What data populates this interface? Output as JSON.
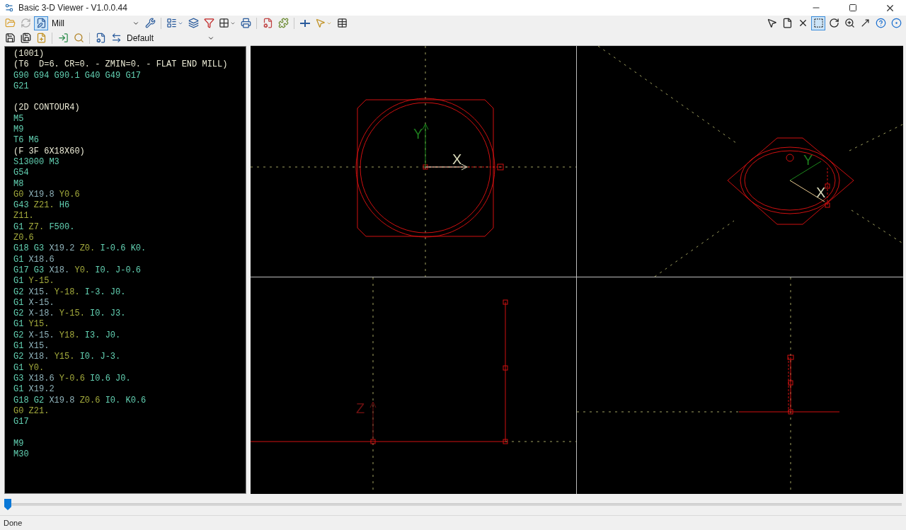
{
  "window": {
    "title": "Basic 3-D Viewer - V1.0.0.44"
  },
  "toolbar": {
    "machine": "Mill",
    "profile": "Default",
    "left_tools": [
      {
        "selected": false
      },
      {
        "selected": false
      },
      {
        "selected": true
      }
    ],
    "right_tools": [
      {
        "selected": false
      },
      {
        "selected": false
      },
      {
        "selected": false
      },
      {
        "selected": true
      },
      {
        "selected": false
      },
      {
        "selected": false
      },
      {
        "selected": false
      },
      {
        "selected": false
      },
      {
        "selected": false
      }
    ]
  },
  "program": [
    {
      "kind": "code",
      "tokens": [
        {
          "text": "(1001)",
          "kind": "note"
        }
      ]
    },
    {
      "kind": "code",
      "tokens": [
        {
          "text": "(T6  D=6. CR=0. - ZMIN=0. - FLAT END MILL)",
          "kind": "note"
        }
      ]
    },
    {
      "kind": "code",
      "tokens": [
        {
          "text": "G90 G94 G90.1 G40 G49 G17",
          "kind": "word"
        }
      ]
    },
    {
      "kind": "code",
      "tokens": [
        {
          "text": "G21",
          "kind": "word"
        }
      ]
    },
    {
      "kind": "blank"
    },
    {
      "kind": "code",
      "tokens": [
        {
          "text": "(2D CONTOUR4)",
          "kind": "note"
        }
      ]
    },
    {
      "kind": "code",
      "tokens": [
        {
          "text": "M5",
          "kind": "word"
        }
      ]
    },
    {
      "kind": "code",
      "tokens": [
        {
          "text": "M9",
          "kind": "word"
        }
      ]
    },
    {
      "kind": "code",
      "tokens": [
        {
          "text": "T6 M6",
          "kind": "word"
        }
      ]
    },
    {
      "kind": "code",
      "tokens": [
        {
          "text": "(F 3F 6X18X60)",
          "kind": "note"
        }
      ]
    },
    {
      "kind": "code",
      "tokens": [
        {
          "text": "S13000 M3",
          "kind": "word"
        }
      ]
    },
    {
      "kind": "code",
      "tokens": [
        {
          "text": "G54",
          "kind": "word"
        }
      ]
    },
    {
      "kind": "code",
      "tokens": [
        {
          "text": "M8",
          "kind": "word"
        }
      ]
    },
    {
      "kind": "code",
      "tokens": [
        {
          "text": "G0",
          "kind": "yz"
        },
        {
          "text": "X19.8",
          "kind": "x"
        },
        {
          "text": "Y0.6",
          "kind": "yz"
        }
      ]
    },
    {
      "kind": "code",
      "tokens": [
        {
          "text": "G43",
          "kind": "word"
        },
        {
          "text": "Z21.",
          "kind": "yz"
        },
        {
          "text": "H6",
          "kind": "word"
        }
      ]
    },
    {
      "kind": "code",
      "tokens": [
        {
          "text": "Z11.",
          "kind": "yz"
        }
      ]
    },
    {
      "kind": "code",
      "tokens": [
        {
          "text": "G1",
          "kind": "word"
        },
        {
          "text": "Z7.",
          "kind": "yz"
        },
        {
          "text": "F500.",
          "kind": "word"
        }
      ]
    },
    {
      "kind": "code",
      "tokens": [
        {
          "text": "Z0.6",
          "kind": "yz"
        }
      ]
    },
    {
      "kind": "code",
      "tokens": [
        {
          "text": "G18 G3",
          "kind": "word"
        },
        {
          "text": "X19.2",
          "kind": "x"
        },
        {
          "text": "Z0.",
          "kind": "yz"
        },
        {
          "text": "I-0.6 K0.",
          "kind": "word"
        }
      ]
    },
    {
      "kind": "code",
      "tokens": [
        {
          "text": "G1",
          "kind": "word"
        },
        {
          "text": "X18.6",
          "kind": "x"
        }
      ]
    },
    {
      "kind": "code",
      "tokens": [
        {
          "text": "G17 G3",
          "kind": "word"
        },
        {
          "text": "X18.",
          "kind": "x"
        },
        {
          "text": "Y0.",
          "kind": "yz"
        },
        {
          "text": "I0. J-0.6",
          "kind": "word"
        }
      ]
    },
    {
      "kind": "code",
      "tokens": [
        {
          "text": "G1",
          "kind": "word"
        },
        {
          "text": "Y-15.",
          "kind": "yz"
        }
      ]
    },
    {
      "kind": "code",
      "tokens": [
        {
          "text": "G2",
          "kind": "word"
        },
        {
          "text": "X15.",
          "kind": "x"
        },
        {
          "text": "Y-18.",
          "kind": "yz"
        },
        {
          "text": "I-3. J0.",
          "kind": "word"
        }
      ]
    },
    {
      "kind": "code",
      "tokens": [
        {
          "text": "G1",
          "kind": "word"
        },
        {
          "text": "X-15.",
          "kind": "x"
        }
      ]
    },
    {
      "kind": "code",
      "tokens": [
        {
          "text": "G2",
          "kind": "word"
        },
        {
          "text": "X-18.",
          "kind": "x"
        },
        {
          "text": "Y-15.",
          "kind": "yz"
        },
        {
          "text": "I0. J3.",
          "kind": "word"
        }
      ]
    },
    {
      "kind": "code",
      "tokens": [
        {
          "text": "G1",
          "kind": "word"
        },
        {
          "text": "Y15.",
          "kind": "yz"
        }
      ]
    },
    {
      "kind": "code",
      "tokens": [
        {
          "text": "G2",
          "kind": "word"
        },
        {
          "text": "X-15.",
          "kind": "x"
        },
        {
          "text": "Y18.",
          "kind": "yz"
        },
        {
          "text": "I3. J0.",
          "kind": "word"
        }
      ]
    },
    {
      "kind": "code",
      "tokens": [
        {
          "text": "G1",
          "kind": "word"
        },
        {
          "text": "X15.",
          "kind": "x"
        }
      ]
    },
    {
      "kind": "code",
      "tokens": [
        {
          "text": "G2",
          "kind": "word"
        },
        {
          "text": "X18.",
          "kind": "x"
        },
        {
          "text": "Y15.",
          "kind": "yz"
        },
        {
          "text": "I0. J-3.",
          "kind": "word"
        }
      ]
    },
    {
      "kind": "code",
      "tokens": [
        {
          "text": "G1",
          "kind": "word"
        },
        {
          "text": "Y0.",
          "kind": "yz"
        }
      ]
    },
    {
      "kind": "code",
      "tokens": [
        {
          "text": "G3",
          "kind": "word"
        },
        {
          "text": "X18.6",
          "kind": "x"
        },
        {
          "text": "Y-0.6",
          "kind": "yz"
        },
        {
          "text": "I0.6 J0.",
          "kind": "word"
        }
      ]
    },
    {
      "kind": "code",
      "tokens": [
        {
          "text": "G1",
          "kind": "word"
        },
        {
          "text": "X19.2",
          "kind": "x"
        }
      ]
    },
    {
      "kind": "code",
      "tokens": [
        {
          "text": "G18 G2",
          "kind": "word"
        },
        {
          "text": "X19.8",
          "kind": "x"
        },
        {
          "text": "Z0.6",
          "kind": "yz"
        },
        {
          "text": "I0. K0.6",
          "kind": "word"
        }
      ]
    },
    {
      "kind": "code",
      "tokens": [
        {
          "text": "G0 Z21.",
          "kind": "yz"
        }
      ]
    },
    {
      "kind": "code",
      "tokens": [
        {
          "text": "G17",
          "kind": "word"
        }
      ]
    },
    {
      "kind": "blank"
    },
    {
      "kind": "code",
      "tokens": [
        {
          "text": "M9",
          "kind": "word"
        }
      ]
    },
    {
      "kind": "code",
      "tokens": [
        {
          "text": "M30",
          "kind": "word"
        }
      ]
    }
  ],
  "viewports": [
    {
      "kind": "top",
      "labels": [
        "Y",
        "X"
      ]
    },
    {
      "kind": "iso",
      "labels": [
        "Y",
        "X"
      ]
    },
    {
      "kind": "front",
      "labels": [
        "Z"
      ]
    },
    {
      "kind": "side"
    }
  ],
  "playback": {
    "level": 0
  },
  "status_bar": {
    "text": "Done"
  }
}
